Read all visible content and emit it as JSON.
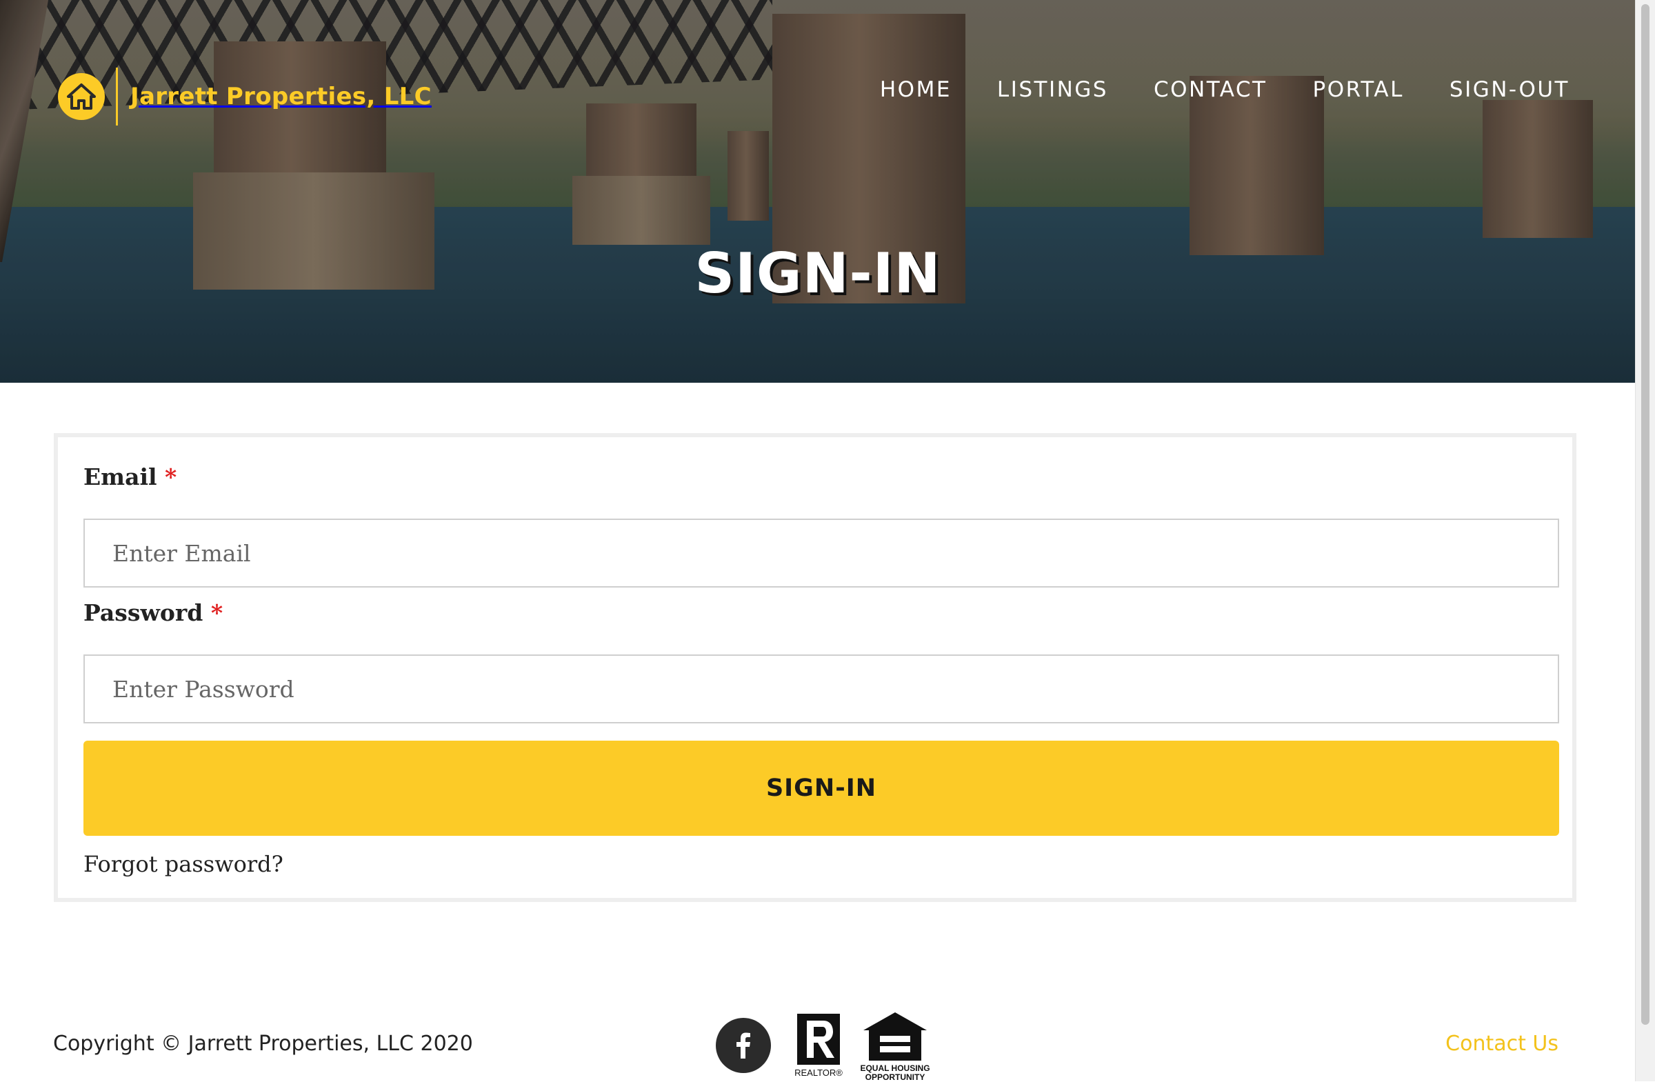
{
  "brand": {
    "name": "Jarrett Properties, LLC",
    "icon": "house-icon",
    "color": "#fccb27"
  },
  "nav": {
    "items": [
      "HOME",
      "LISTINGS",
      "CONTACT",
      "PORTAL",
      "SIGN-OUT"
    ]
  },
  "hero": {
    "title": "SIGN-IN"
  },
  "form": {
    "email": {
      "label": "Email",
      "required_mark": "*",
      "placeholder": "Enter Email",
      "value": ""
    },
    "password": {
      "label": "Password",
      "required_mark": "*",
      "placeholder": "Enter Password",
      "value": ""
    },
    "submit_label": "SIGN-IN",
    "forgot_label": "Forgot password?"
  },
  "footer": {
    "copyright": "Copyright © Jarrett Properties, LLC 2020",
    "social_icon": "facebook-icon",
    "badges": [
      "realtor-logo",
      "equal-housing-opportunity-logo"
    ],
    "realtor_text": "REALTOR®",
    "equal_housing_text_1": "EQUAL HOUSING",
    "equal_housing_text_2": "OPPORTUNITY",
    "contact_label": "Contact Us"
  },
  "colors": {
    "accent": "#fccb27",
    "required": "#e02020",
    "footer_link": "#f3c21c"
  }
}
